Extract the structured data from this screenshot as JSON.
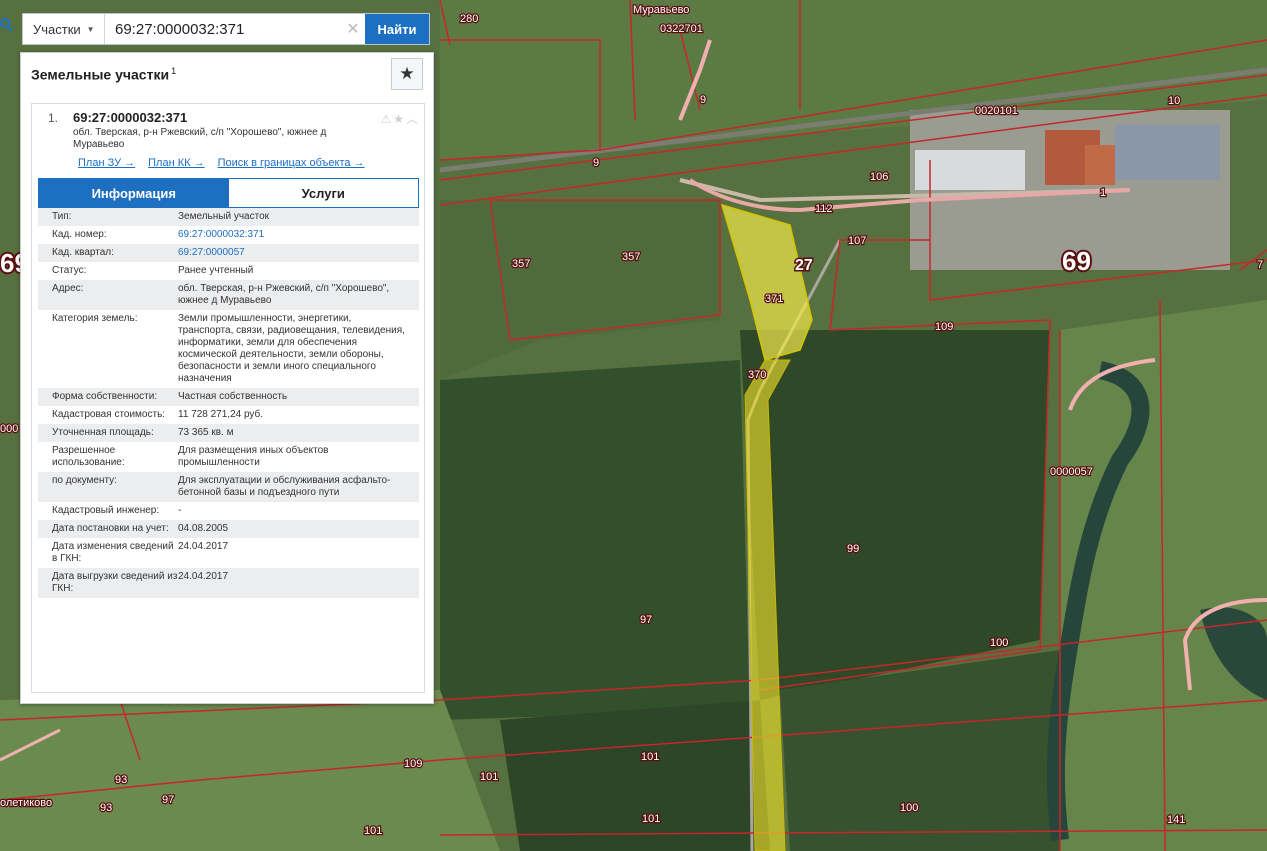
{
  "search": {
    "type_label": "Участки",
    "query": "69:27:0000032:371",
    "button_label": "Найти"
  },
  "panel": {
    "title": "Земельные участки",
    "count": "1"
  },
  "result": {
    "index": "1.",
    "cad_number": "69:27:0000032:371",
    "address_short": "обл. Тверская, р-н Ржевский, с/п \"Хорошево\", южнее д Муравьево",
    "links": [
      "План ЗУ →",
      "План КК →",
      "Поиск в границах объекта →"
    ],
    "tabs": [
      "Информация",
      "Услуги"
    ],
    "properties": [
      {
        "label": "Тип:",
        "value": "Земельный участок"
      },
      {
        "label": "Кад. номер:",
        "value": "69:27:0000032:371",
        "link": true
      },
      {
        "label": "Кад. квартал:",
        "value": "69:27:0000057",
        "link": true
      },
      {
        "label": "Статус:",
        "value": "Ранее учтенный"
      },
      {
        "label": "Адрес:",
        "value": "обл. Тверская, р-н Ржевский, с/п \"Хорошево\", южнее д Муравьево"
      },
      {
        "label": "Категория земель:",
        "value": "Земли промышленности, энергетики, транспорта, связи, радиовещания, телевидения, информатики, земли для обеспечения космической деятельности, земли обороны, безопасности и земли иного специального назначения"
      },
      {
        "label": "Форма собственности:",
        "value": "Частная собственность"
      },
      {
        "label": "Кадастровая стоимость:",
        "value": "11 728 271,24 руб."
      },
      {
        "label": "Уточненная площадь:",
        "value": "73 365 кв. м"
      },
      {
        "label": "Разрешенное использование:",
        "value": "Для размещения иных объектов промышленности"
      },
      {
        "label": "по документу:",
        "value": "Для эксплуатации и обслуживания асфальто-бетонной базы и подъездного пути"
      },
      {
        "label": "Кадастровый инженер:",
        "value": "-"
      },
      {
        "label": "Дата постановки на учет:",
        "value": "04.08.2005"
      },
      {
        "label": "Дата изменения сведений в ГКН:",
        "value": "24.04.2017"
      },
      {
        "label": "Дата выгрузки сведений из ГКН:",
        "value": "24.04.2017"
      }
    ]
  },
  "map": {
    "labels": {
      "village_north": "Муравьево",
      "village_sw": "олетиково",
      "q1": "0322701",
      "q2": "0020101",
      "q3": "0000057",
      "district": "69",
      "district_left": "69",
      "quarter_27": "27",
      "parcel_371": "371",
      "parcel_370": "370",
      "n280": "280",
      "n9a": "9",
      "n9b": "9",
      "n10": "10",
      "n106": "106",
      "n112": "112",
      "n107": "107",
      "n1": "1",
      "n357a": "357",
      "n357b": "357",
      "n109a": "109",
      "n109b": "109",
      "n99": "99",
      "n97a": "97",
      "n97b": "97",
      "n100a": "100",
      "n100b": "100",
      "n101a": "101",
      "n101b": "101",
      "n101c": "101",
      "n101d": "101",
      "n93a": "93",
      "n93b": "93",
      "n141": "141",
      "n7": "7",
      "n000": "000"
    },
    "colors": {
      "parcel_border": "#c8262a",
      "selected_fill": "#f2e94a",
      "forest": "#2f4a2a",
      "field": "#5f7d45"
    }
  }
}
